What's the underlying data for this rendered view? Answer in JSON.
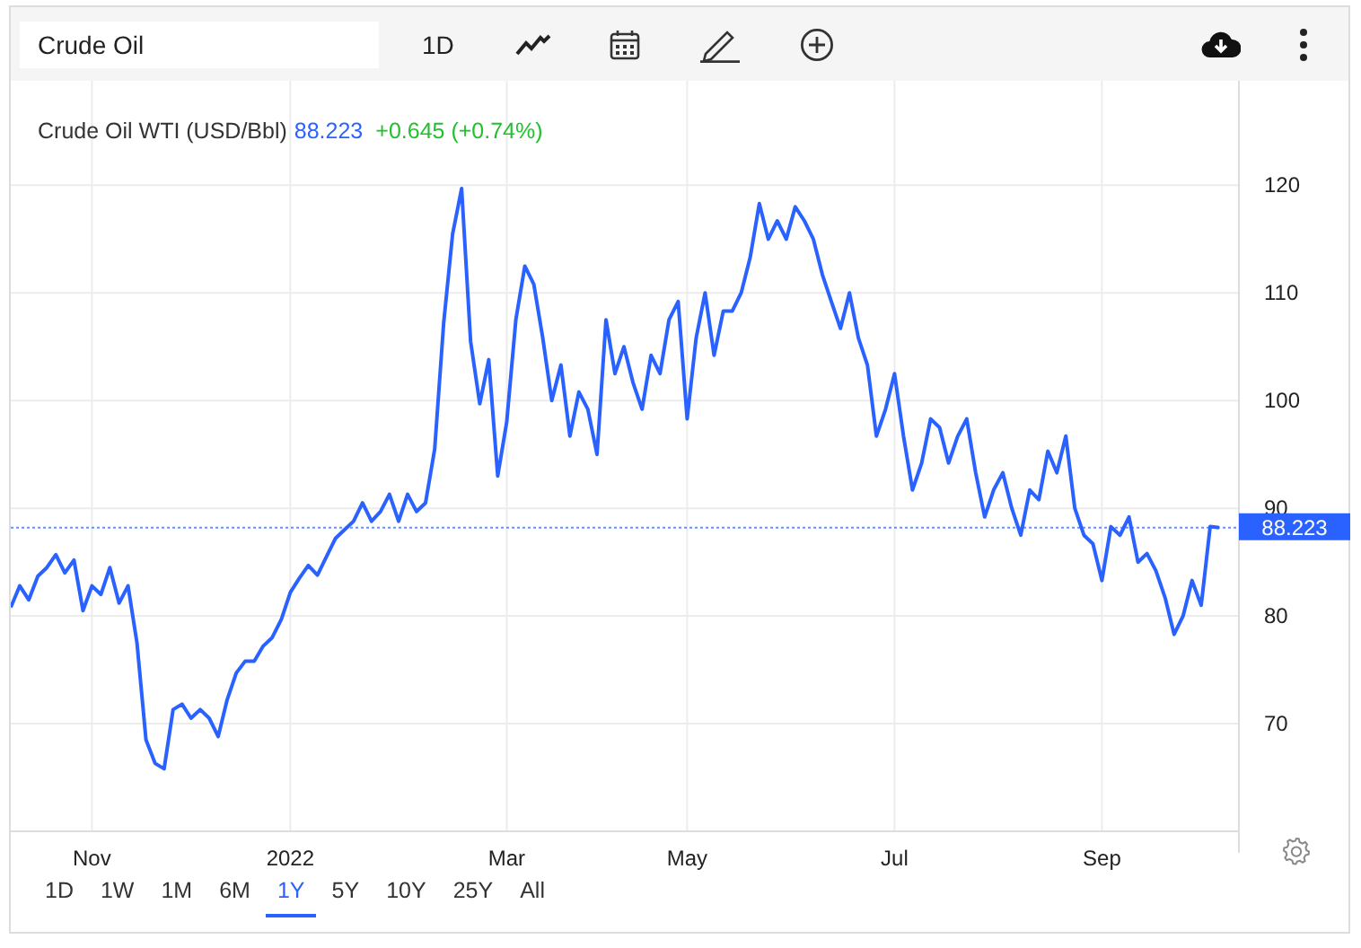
{
  "toolbar": {
    "search": {
      "value": "Crude Oil"
    },
    "interval": "1D"
  },
  "legend": {
    "price": "88.223",
    "change": "+0.645 (+0.74%)"
  },
  "price_tag": "88.223",
  "chart_data": {
    "type": "line",
    "categories": [
      null,
      null,
      null,
      null,
      null,
      null,
      null,
      null,
      null,
      "Nov",
      null,
      null,
      null,
      null,
      null,
      null,
      null,
      null,
      null,
      null,
      null,
      null,
      null,
      null,
      null,
      null,
      null,
      null,
      null,
      null,
      null,
      "2022",
      null,
      null,
      null,
      null,
      null,
      null,
      null,
      null,
      null,
      null,
      null,
      null,
      null,
      null,
      null,
      null,
      null,
      null,
      null,
      null,
      null,
      null,
      null,
      "Mar",
      null,
      null,
      null,
      null,
      null,
      null,
      null,
      null,
      null,
      null,
      null,
      null,
      null,
      null,
      null,
      null,
      null,
      null,
      null,
      "May",
      null,
      null,
      null,
      null,
      null,
      null,
      null,
      null,
      null,
      null,
      null,
      null,
      null,
      null,
      null,
      null,
      null,
      null,
      null,
      null,
      null,
      null,
      "Jul",
      null,
      null,
      null,
      null,
      null,
      null,
      null,
      null,
      null,
      null,
      null,
      null,
      null,
      null,
      null,
      null,
      null,
      null,
      null,
      null,
      null,
      null,
      "Sep",
      null,
      null,
      null,
      null,
      null,
      null,
      null,
      null,
      null,
      null,
      null,
      null,
      null
    ],
    "series": [
      {
        "name": "Crude Oil WTI (USD/Bbl)",
        "color": "#2962ff",
        "values": [
          80.8,
          82.8,
          81.5,
          83.7,
          84.5,
          85.7,
          84,
          85.2,
          80.5,
          82.8,
          82,
          84.5,
          81.2,
          82.8,
          77.5,
          68.5,
          66.3,
          65.8,
          71.3,
          71.8,
          70.5,
          71.3,
          70.5,
          68.8,
          72.2,
          74.7,
          75.8,
          75.8,
          77.2,
          78,
          79.7,
          82.2,
          83.5,
          84.7,
          83.8,
          85.5,
          87.2,
          88,
          88.8,
          90.5,
          88.8,
          89.7,
          91.3,
          88.8,
          91.3,
          89.7,
          90.5,
          95.5,
          107.2,
          115.5,
          119.7,
          105.5,
          99.7,
          103.8,
          93,
          98,
          107.5,
          112.5,
          110.8,
          105.8,
          100,
          103.3,
          96.7,
          100.8,
          99.2,
          95,
          107.5,
          102.5,
          105,
          101.7,
          99.2,
          104.2,
          102.5,
          107.5,
          109.2,
          98.3,
          105.8,
          110,
          104.2,
          108.3,
          108.3,
          110,
          113.3,
          118.3,
          115,
          116.7,
          115,
          118,
          116.7,
          115,
          111.7,
          109.2,
          106.7,
          110,
          105.8,
          103.3,
          96.7,
          99.2,
          102.5,
          96.7,
          91.7,
          94.2,
          98.3,
          97.5,
          94.2,
          96.7,
          98.3,
          93.3,
          89.2,
          91.7,
          93.3,
          90,
          87.5,
          91.7,
          90.8,
          95.3,
          93.3,
          96.7,
          90,
          87.5,
          86.7,
          83.3,
          88.3,
          87.5,
          89.2,
          85,
          85.8,
          84.2,
          81.7,
          78.3,
          80,
          83.3,
          81,
          88.3,
          88.2
        ]
      }
    ],
    "ylim": [
      60,
      129.7
    ],
    "grid": true,
    "ref_lines": [
      {
        "axis": "y",
        "value": 88.2
      }
    ],
    "yticks": [
      70,
      80,
      90,
      100,
      110,
      120
    ]
  },
  "ranges": [
    {
      "label": "1D",
      "selected": false
    },
    {
      "label": "1W",
      "selected": false
    },
    {
      "label": "1M",
      "selected": false
    },
    {
      "label": "6M",
      "selected": false
    },
    {
      "label": "1Y",
      "selected": true
    },
    {
      "label": "5Y",
      "selected": false
    },
    {
      "label": "10Y",
      "selected": false
    },
    {
      "label": "25Y",
      "selected": false
    },
    {
      "label": "All",
      "selected": false
    }
  ]
}
